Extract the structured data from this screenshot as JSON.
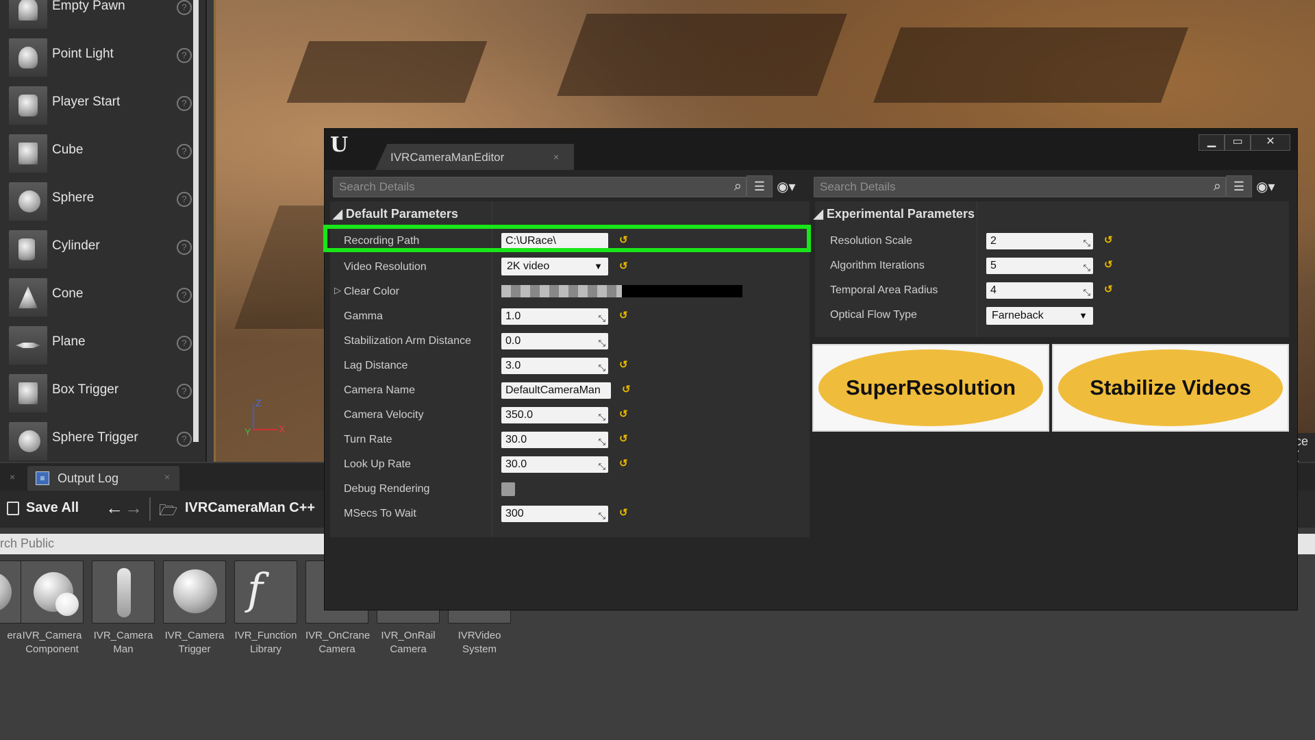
{
  "palette": {
    "items": [
      {
        "label": "Empty Pawn",
        "icon": "pawn-icon"
      },
      {
        "label": "Point Light",
        "icon": "point-light-icon"
      },
      {
        "label": "Player Start",
        "icon": "player-start-icon"
      },
      {
        "label": "Cube",
        "icon": "cube-icon"
      },
      {
        "label": "Sphere",
        "icon": "sphere-icon"
      },
      {
        "label": "Cylinder",
        "icon": "cylinder-icon"
      },
      {
        "label": "Cone",
        "icon": "cone-icon"
      },
      {
        "label": "Plane",
        "icon": "plane-icon"
      },
      {
        "label": "Box Trigger",
        "icon": "box-trigger-icon"
      },
      {
        "label": "Sphere Trigger",
        "icon": "sphere-trigger-icon"
      }
    ],
    "help_glyph": "?"
  },
  "output_log": {
    "tab_label": "Output Log",
    "close_glyph": "×"
  },
  "toolbar": {
    "save_all": "Save All",
    "path": "IVRCameraMan C++"
  },
  "content_browser": {
    "search_text": "rch Public",
    "assets": [
      {
        "line1": "era",
        "line2": ""
      },
      {
        "line1": "IVR_Camera",
        "line2": "Component"
      },
      {
        "line1": "IVR_Camera",
        "line2": "Man"
      },
      {
        "line1": "IVR_Camera",
        "line2": "Trigger"
      },
      {
        "line1": "IVR_Function",
        "line2": "Library"
      },
      {
        "line1": "IVR_OnCrane",
        "line2": "Camera"
      },
      {
        "line1": "IVR_OnRail",
        "line2": "Camera"
      },
      {
        "line1": "IVRVideo",
        "line2": "System"
      }
    ]
  },
  "viewport": {
    "axis_x": "X",
    "axis_y": "Y",
    "axis_z": "Z",
    "edge_text": "ce ("
  },
  "editor": {
    "tab_title": "IVRCameraManEditor",
    "tab_close": "×",
    "window_buttons": {
      "minimize": "▁",
      "maximize": "▭",
      "close": "✕"
    },
    "left_search_placeholder": "Search Details",
    "right_search_placeholder": "Search Details",
    "default_params": {
      "header": "Default Parameters",
      "rows": [
        {
          "label": "Recording Path",
          "value": "C:\\URace\\",
          "kind": "text"
        },
        {
          "label": "Video Resolution",
          "value": "2K video",
          "kind": "combo"
        },
        {
          "label": "Clear Color",
          "value": "",
          "kind": "color"
        },
        {
          "label": "Gamma",
          "value": "1.0",
          "kind": "spin"
        },
        {
          "label": "Stabilization Arm Distance",
          "value": "0.0",
          "kind": "spin"
        },
        {
          "label": "Lag Distance",
          "value": "3.0",
          "kind": "spin"
        },
        {
          "label": "Camera Name",
          "value": "DefaultCameraMan",
          "kind": "text"
        },
        {
          "label": "Camera Velocity",
          "value": "350.0",
          "kind": "spin"
        },
        {
          "label": "Turn Rate",
          "value": "30.0",
          "kind": "spin"
        },
        {
          "label": "Look Up Rate",
          "value": "30.0",
          "kind": "spin"
        },
        {
          "label": "Debug Rendering",
          "value": "",
          "kind": "checkbox"
        },
        {
          "label": "MSecs To Wait",
          "value": "300",
          "kind": "spin"
        }
      ]
    },
    "experimental_params": {
      "header": "Experimental Parameters",
      "rows": [
        {
          "label": "Resolution Scale",
          "value": "2"
        },
        {
          "label": "Algorithm Iterations",
          "value": "5"
        },
        {
          "label": "Temporal Area Radius",
          "value": "4"
        },
        {
          "label": "Optical Flow Type",
          "value": "Farneback"
        }
      ]
    },
    "buttons": {
      "super_resolution": "SuperResolution",
      "stabilize_videos": "Stabilize Videos"
    },
    "highlight_color": "#19e619",
    "accent_color": "#f0bc3c"
  }
}
